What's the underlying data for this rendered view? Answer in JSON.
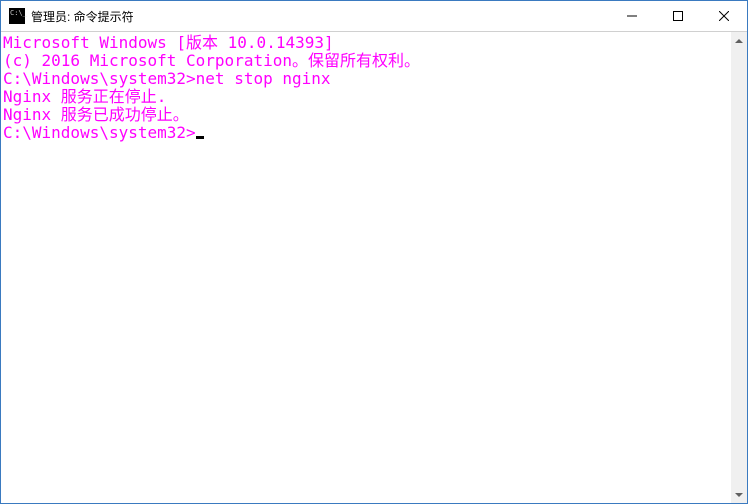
{
  "window": {
    "title": "管理员: 命令提示符"
  },
  "terminal": {
    "lines": [
      "Microsoft Windows [版本 10.0.14393]",
      "(c) 2016 Microsoft Corporation。保留所有权利。",
      "",
      "C:\\Windows\\system32>net stop nginx",
      "Nginx 服务正在停止.",
      "Nginx 服务已成功停止。",
      "",
      ""
    ],
    "prompt": "C:\\Windows\\system32>"
  }
}
